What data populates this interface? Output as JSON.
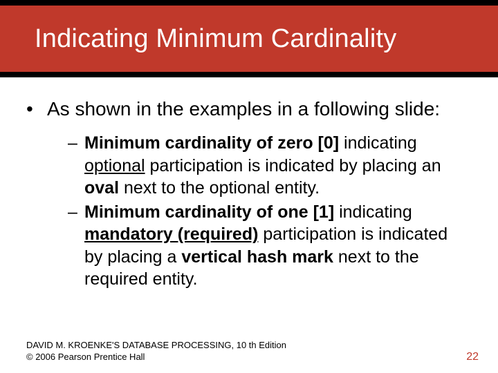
{
  "title": "Indicating Minimum Cardinality",
  "lead": "As shown in the examples in a following slide:",
  "sub1": {
    "s1": "Minimum cardinality of zero [0]",
    "s2": " indicating ",
    "s3": "optional",
    "s4": " participation is indicated by placing an ",
    "s5": "oval",
    "s6": " next to the optional entity."
  },
  "sub2": {
    "s1": "Minimum cardinality of one [1]",
    "s2": " indicating ",
    "s3": "mandatory (required)",
    "s4": " participation is indicated by placing a ",
    "s5": "vertical hash mark",
    "s6": " next to the required entity."
  },
  "footer": {
    "line1": "DAVID M. KROENKE'S DATABASE PROCESSING, 10 th Edition",
    "line2": "© 2006 Pearson Prentice Hall",
    "page": "22"
  }
}
